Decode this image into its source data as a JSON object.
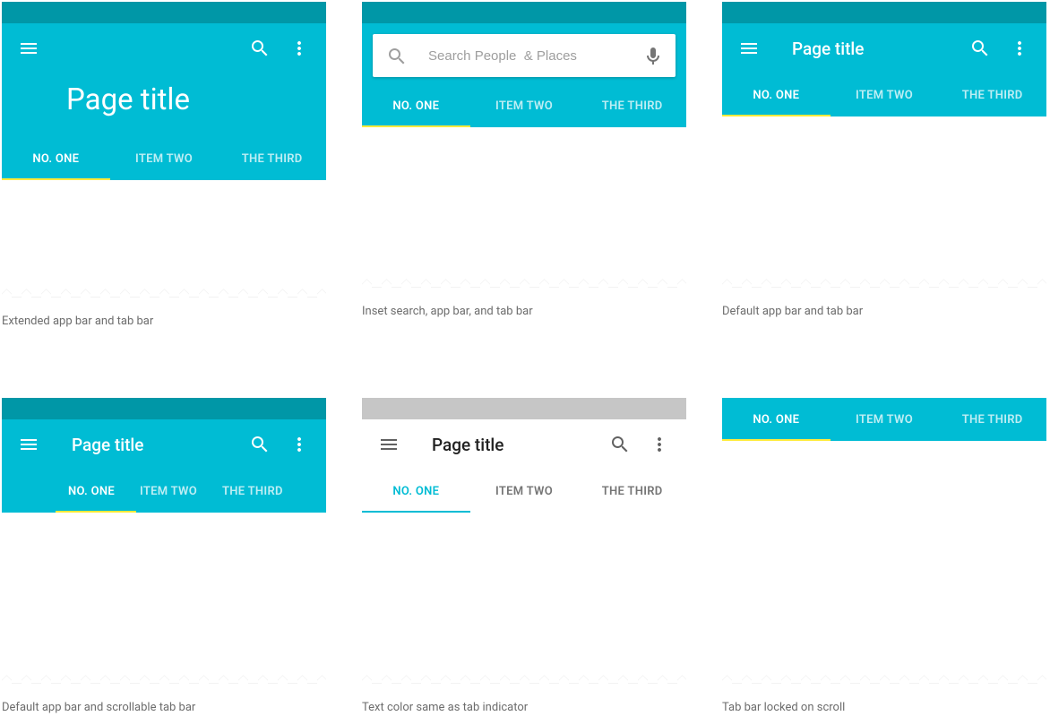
{
  "colors": {
    "primary": "#00bcd4",
    "primary_dark": "#0097a7",
    "accent": "#ffeb3b",
    "text_light": "#ffffff",
    "text_dark": "#212121",
    "text_muted": "#757575",
    "caption": "#6d6d6d"
  },
  "icons": {
    "menu": "menu-icon",
    "search": "search-icon",
    "more_vert": "more-vert-icon",
    "mic": "mic-icon"
  },
  "page_title": "Page title",
  "search": {
    "placeholder": "Search People  & Places"
  },
  "tabs": [
    {
      "label": "NO. ONE",
      "active": true
    },
    {
      "label": "ITEM TWO",
      "active": false
    },
    {
      "label": "THE THIRD",
      "active": false
    }
  ],
  "examples": [
    {
      "id": "extended",
      "caption": "Extended app bar and tab bar"
    },
    {
      "id": "inset-search",
      "caption": "Inset search, app bar, and tab bar"
    },
    {
      "id": "default",
      "caption": "Default app bar and tab bar"
    },
    {
      "id": "scrollable-tabs",
      "caption": "Default app bar and scrollable tab bar"
    },
    {
      "id": "text-color",
      "caption": "Text color same as tab indicator"
    },
    {
      "id": "locked-tabs",
      "caption": "Tab bar locked on scroll"
    }
  ]
}
